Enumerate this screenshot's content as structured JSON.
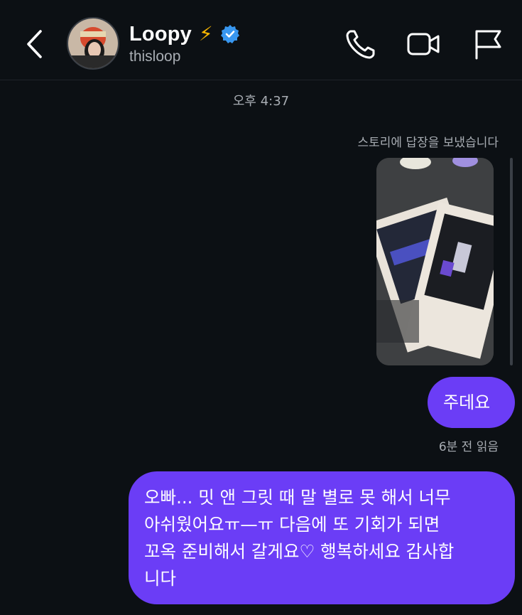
{
  "header": {
    "name": "Loopy",
    "bolt_emoji": "⚡",
    "handle": "thisloop",
    "icons": {
      "back": "chevron-left-icon",
      "call": "phone-icon",
      "video": "video-camera-icon",
      "report": "flag-icon",
      "verified": "verified-badge-icon"
    }
  },
  "thread": {
    "timestamp": "오후 4:37",
    "story_note": "스토리에 답장을 보냈습니다",
    "messages": [
      {
        "text": "주데요"
      },
      {
        "text": "오빠... 밋 앤 그릿 때 말 별로 못 해서 너무\n아쉬웠어요ㅠ—ㅠ 다음에 또 기회가 되면\n꼬옥 준비해서 갈게요♡ 행복하세요 감사합\n니다"
      }
    ],
    "read_receipt": "6분 전 읽음"
  },
  "colors": {
    "background": "#0c1014",
    "bubble": "#6b3df6",
    "verified": "#3897f0",
    "bolt": "#f5b400",
    "muted_text": "#a8adb3"
  }
}
